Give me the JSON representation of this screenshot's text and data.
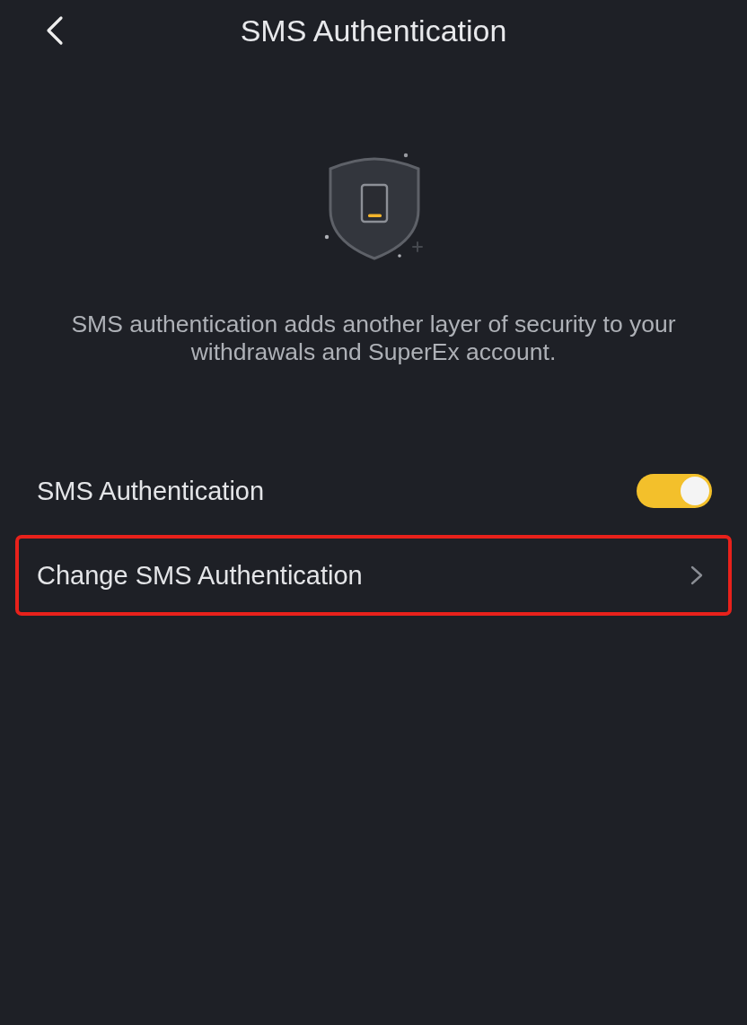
{
  "header": {
    "title": "SMS Authentication"
  },
  "intro": {
    "text": "SMS authentication adds another layer of security to your withdrawals and SuperEx account."
  },
  "settings": [
    {
      "kind": "toggle",
      "label": "SMS Authentication",
      "on": true,
      "highlighted": false
    },
    {
      "kind": "link",
      "label": "Change SMS Authentication",
      "highlighted": true
    }
  ]
}
